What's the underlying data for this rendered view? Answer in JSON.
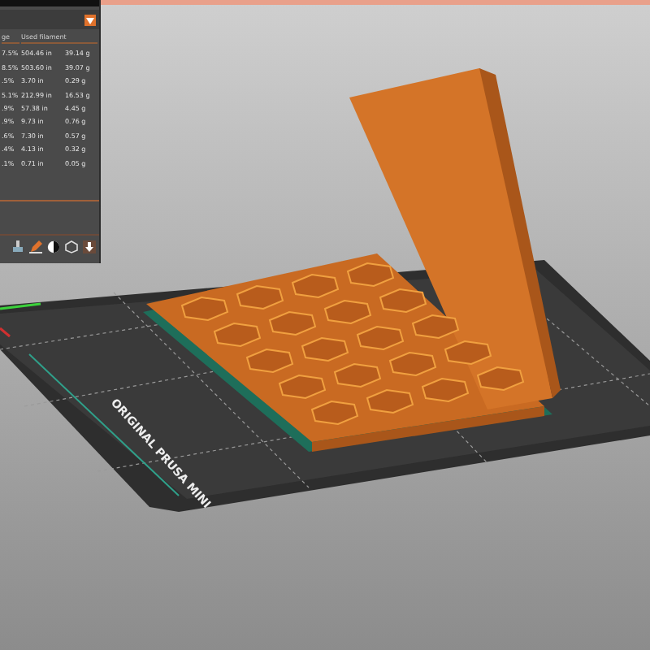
{
  "stats_panel": {
    "columns": [
      "ge",
      "Used filament"
    ],
    "rows": [
      {
        "share": "7.5%",
        "length": "504.46 in",
        "weight": "39.14 g"
      },
      {
        "share": "8.5%",
        "length": "503.60 in",
        "weight": "39.07 g"
      },
      {
        "share": ".5%",
        "length": "3.70 in",
        "weight": "0.29 g"
      },
      {
        "share": "5.1%",
        "length": "212.99 in",
        "weight": "16.53 g"
      },
      {
        "share": ".9%",
        "length": "57.38 in",
        "weight": "4.45 g"
      },
      {
        "share": ".9%",
        "length": "9.73 in",
        "weight": "0.76 g"
      },
      {
        "share": ".6%",
        "length": "7.30 in",
        "weight": "0.57 g"
      },
      {
        "share": ".4%",
        "length": "4.13 in",
        "weight": "0.32 g"
      },
      {
        "share": ".1%",
        "length": "0.71 in",
        "weight": "0.05 g"
      }
    ]
  },
  "bed": {
    "label": "ORIGINAL PRUSA MINI"
  }
}
